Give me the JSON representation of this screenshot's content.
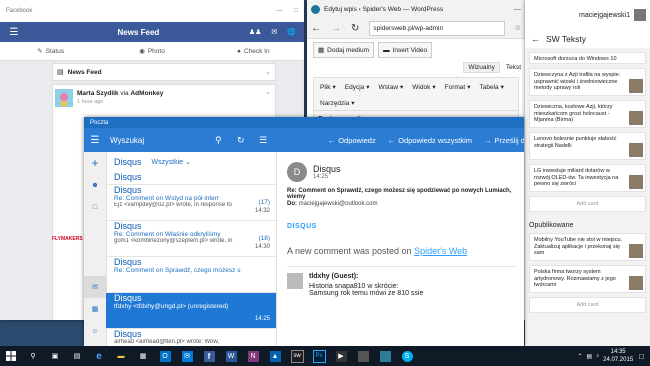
{
  "facebook": {
    "window_title": "Facebook",
    "header_title": "News Feed",
    "actions": {
      "status": "Status",
      "photo": "Photo",
      "checkin": "Check In"
    },
    "feed_label": "News Feed",
    "post": {
      "author": "Marta Szydlik",
      "via": "via",
      "app": "AdMonkey",
      "time": "1 hour ago"
    },
    "ad_text": "FLYMAKERS"
  },
  "wordpress": {
    "tab_title": "Edytuj wpis ‹ Spider's Web — WordPress",
    "url": "spidersweb.pl/wp-admin",
    "add_media": "Dodaj medium",
    "insert_video": "Insert Video",
    "tab_visual": "Wizualny",
    "tab_text": "Tekst",
    "menu": [
      "Plik",
      "Edycja",
      "Wstaw",
      "Widok",
      "Format",
      "Tabela"
    ],
    "menu2": "Narzędzia"
  },
  "swteksty": {
    "user": "maciejgajewski1",
    "title": "SW Teksty",
    "items_top": [
      {
        "text": "Microsoft dorzuca do Windows 10 koszmarnie wiele nowości. Podgląd: ...",
        "partial": true
      },
      {
        "text": "Dziewczyna z Azji trafiła na wyspie: usprawnić wioski i średniowieczne metody uprawy roli"
      },
      {
        "text": "Dziewiczna, kozłowe Azji, którzy mieszkańcom grozi holocaust - Mjanma (Birma)"
      },
      {
        "text": "Lenovo bolesnie punktuje słabość strategii Nadelli"
      },
      {
        "text": "LG inwestuje miliard dolarów w rozwój OLED-ów. Ta inwestycja na pewno się zwróci"
      }
    ],
    "load_more": "Add card",
    "section_popular": "Opublikowane",
    "items_pub": [
      {
        "text": "Mobilny YouTube nie stoi w miejscu. Zaktualizuj aplikacje i przekonaj się sam"
      },
      {
        "text": "Polska firma tworzy system artydronowy. Rozmawiamy z jego twórcami"
      }
    ],
    "load_more2": "Add card"
  },
  "mail": {
    "window_title": "Poczta",
    "search": "Wyszukaj",
    "reply": "Odpowiedz",
    "reply_all": "Odpowiedz wszystkim",
    "forward": "Prześlij dalej",
    "folder": "Disqus",
    "filter": "Wszystkie",
    "messages": [
      {
        "from": "Disqus",
        "subject": "",
        "preview": "",
        "time": "",
        "count": "",
        "partial": true
      },
      {
        "from": "Disqus",
        "subject": "Re: Comment on Wstyd na pół interr",
        "preview": "Ejz <vampdey@o2.pl> wrote, in response to",
        "time": "14:32",
        "count": "(17)"
      },
      {
        "from": "Disqus",
        "subject": "Re: Comment on Właśnie odkryliśmy",
        "preview": "gom1 <kombinezony@szeptem.pl> wrote, in response to",
        "time": "14:30",
        "count": "(18)"
      },
      {
        "from": "Disqus",
        "subject": "Re: Comment on Sprawdź, czego możesz s",
        "preview": "",
        "time": "",
        "count": ""
      },
      {
        "from": "Disqus",
        "subject": "tfdxhy <tfdxhy@uhgd.pl> (unregistered)",
        "preview": "",
        "time": "14:25",
        "count": "",
        "selected": true
      },
      {
        "from": "Disqus",
        "subject": "",
        "preview": "airhead <airhead@tlen.pl> wrote: Wow,",
        "time": "14:1",
        "count": "Kosz"
      }
    ],
    "reading": {
      "avatar": "D",
      "sender": "Disqus",
      "time": "14:25",
      "subject": "Re: Comment on Sprawdź, czego możesz się spodziewać po nowych Lumiach,",
      "subject2": "wiemy",
      "to_label": "Do:",
      "to": "maciejgajewski@outlook.com",
      "brand": "DISQUS",
      "new_comment": "A new comment was posted on",
      "site": "Spider's Web",
      "comment_author": "tldxhy (Guest):",
      "comment_line1": "Historia snapa810 w skrócie:",
      "comment_line2": "Samsung rok temu mówi że 810 ssie"
    }
  },
  "taskbar": {
    "time": "14:35",
    "date": "24.07.2015"
  },
  "colors": {
    "facebook_blue": "#3b5998",
    "mail_blue": "#2b7cd3",
    "mail_dark": "#1e6ec2",
    "selected_blue": "#1e78d4"
  }
}
